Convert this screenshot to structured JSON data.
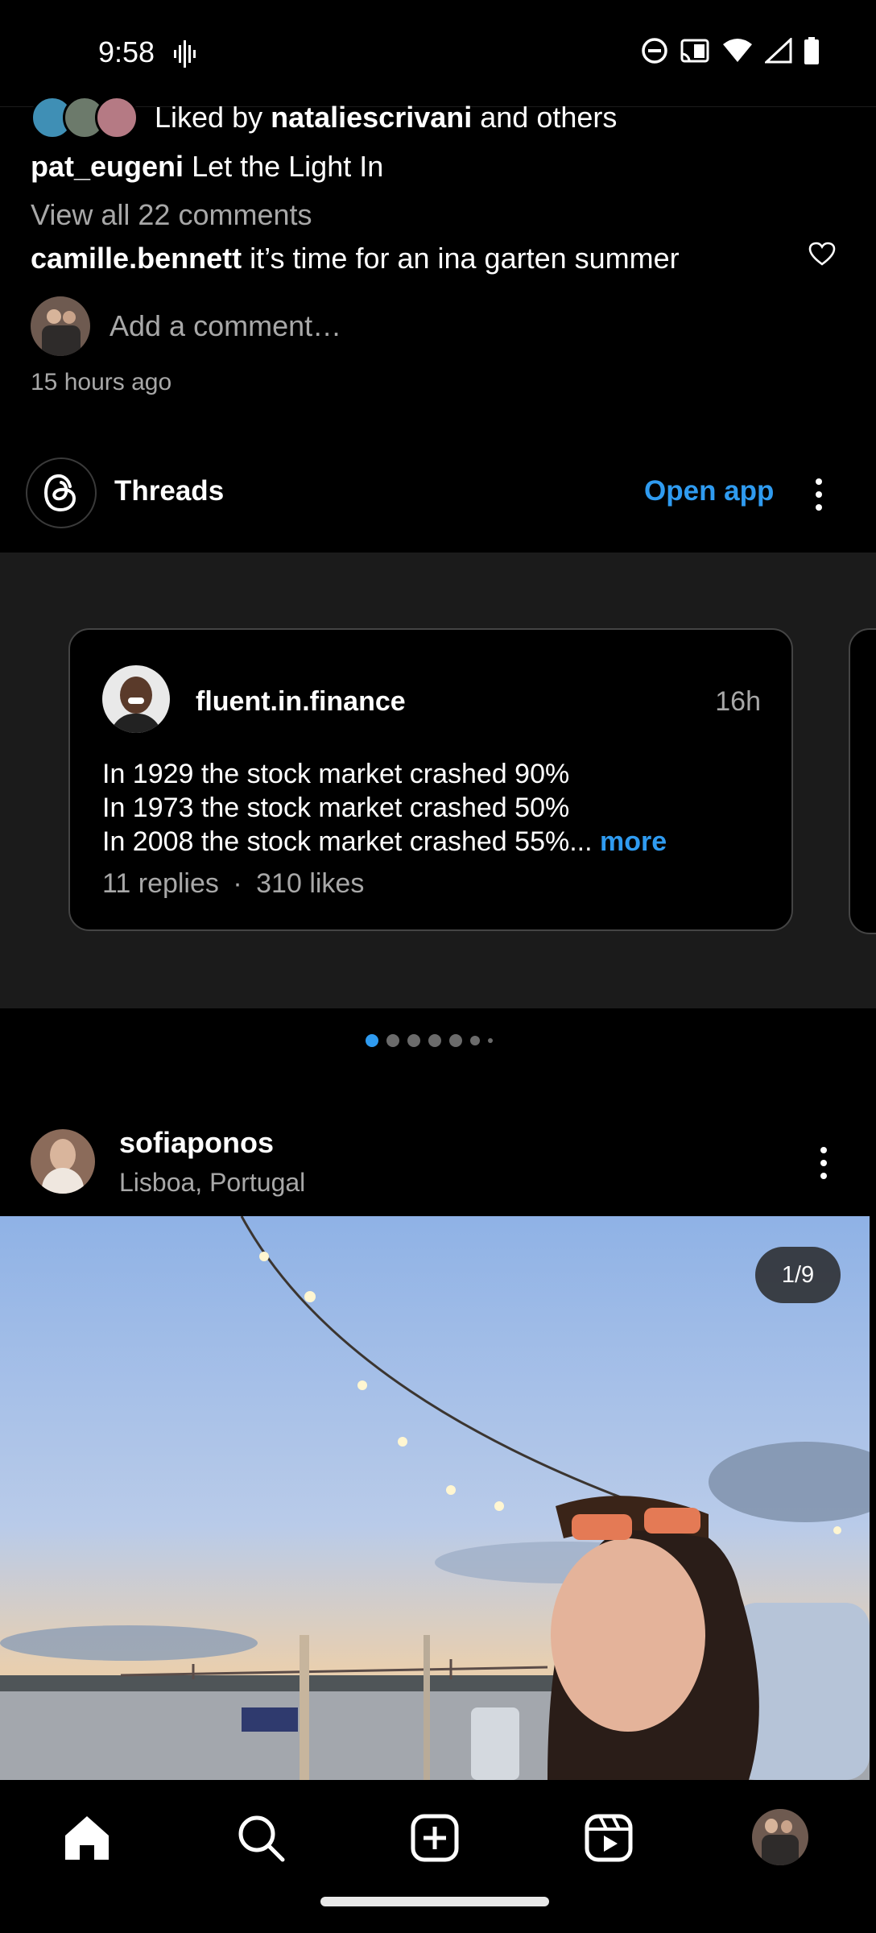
{
  "status_bar": {
    "time": "9:58",
    "icons": [
      "voice-wave-icon",
      "do-not-disturb-icon",
      "cast-icon",
      "wifi-icon",
      "cell-signal-icon",
      "battery-icon"
    ]
  },
  "top_post": {
    "liked_prefix": "Liked by",
    "liked_user": "nataliescrivani",
    "liked_suffix": "and others",
    "caption_user": "pat_eugeni",
    "caption_text": "Let the Light In",
    "view_comments": "View all 22 comments",
    "comment_user": "camille.bennett",
    "comment_text": "it’s time for an ina garten summer",
    "add_comment_placeholder": "Add a comment…",
    "timestamp": "15 hours ago"
  },
  "threads": {
    "title": "Threads",
    "open_app": "Open app",
    "card": {
      "username": "fluent.in.finance",
      "time": "16h",
      "lines": [
        "In 1929 the stock market crashed 90%",
        "In 1973 the stock market crashed 50%",
        "In 2008 the stock market crashed 55%..."
      ],
      "more": "more",
      "replies": "11 replies",
      "separator": "·",
      "likes": "310 likes"
    },
    "pagination_active_index": 0
  },
  "post2": {
    "username": "sofiaponos",
    "location": "Lisboa, Portugal",
    "counter": "1/9"
  },
  "bottom_nav": {
    "items": [
      "home-icon",
      "search-icon",
      "create-post-icon",
      "reels-icon",
      "profile-avatar"
    ]
  },
  "colors": {
    "background": "#000000",
    "accent_blue": "#2f9bf0",
    "muted_text": "#a8a8a8",
    "threads_band": "#1b1b1b"
  }
}
